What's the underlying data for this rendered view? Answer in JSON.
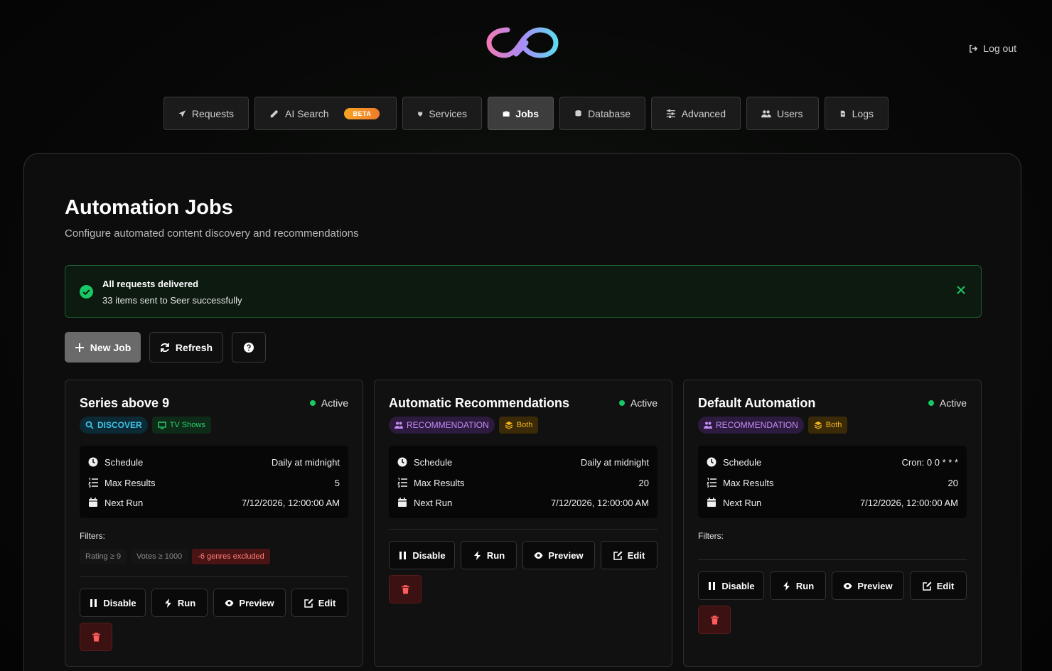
{
  "header": {
    "logout_label": "Log out"
  },
  "nav": {
    "tabs": [
      {
        "label": "Requests",
        "icon": "paper-plane-icon"
      },
      {
        "label": "AI Search",
        "icon": "pencil-icon",
        "badge": "BETA"
      },
      {
        "label": "Services",
        "icon": "plug-icon"
      },
      {
        "label": "Jobs",
        "icon": "briefcase-icon",
        "active": true
      },
      {
        "label": "Database",
        "icon": "database-icon"
      },
      {
        "label": "Advanced",
        "icon": "sliders-icon"
      },
      {
        "label": "Users",
        "icon": "users-icon"
      },
      {
        "label": "Logs",
        "icon": "file-icon"
      }
    ]
  },
  "page": {
    "title": "Automation Jobs",
    "subtitle": "Configure automated content discovery and recommendations"
  },
  "alert": {
    "title": "All requests delivered",
    "message": "33 items sent to Seer successfully",
    "color": "#17c964"
  },
  "toolbar": {
    "new_job_label": "New Job",
    "refresh_label": "Refresh"
  },
  "common": {
    "schedule_label": "Schedule",
    "max_results_label": "Max Results",
    "next_run_label": "Next Run",
    "filters_label": "Filters:",
    "disable_label": "Disable",
    "run_label": "Run",
    "preview_label": "Preview",
    "edit_label": "Edit",
    "status_active": "Active"
  },
  "jobs": [
    {
      "name": "Series above 9",
      "status": "Active",
      "type_tag": "DISCOVER",
      "media_tag": "TV Shows",
      "schedule": "Daily at midnight",
      "max_results": "5",
      "next_run": "7/12/2026, 12:00:00 AM",
      "filters": [
        "Rating ≥ 9",
        "Votes ≥ 1000",
        "-6 genres excluded"
      ]
    },
    {
      "name": "Automatic Recommendations",
      "status": "Active",
      "type_tag": "RECOMMENDATION",
      "media_tag": "Both",
      "schedule": "Daily at midnight",
      "max_results": "20",
      "next_run": "7/12/2026, 12:00:00 AM"
    },
    {
      "name": "Default Automation",
      "status": "Active",
      "type_tag": "RECOMMENDATION",
      "media_tag": "Both",
      "schedule": "Cron: 0 0 * * *",
      "max_results": "20",
      "next_run": "7/12/2026, 12:00:00 AM"
    }
  ]
}
